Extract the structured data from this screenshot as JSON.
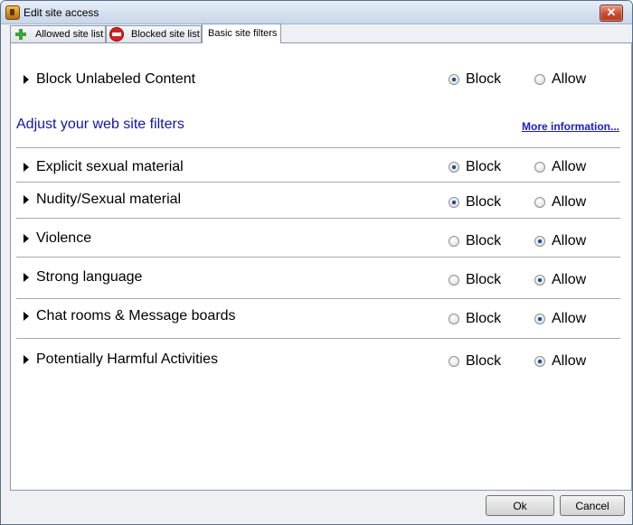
{
  "window": {
    "title": "Edit site access",
    "close_icon": "close-icon",
    "app_icon": "app-icon"
  },
  "tabs": [
    {
      "label": "Allowed site list",
      "icon": "plus-icon",
      "active": false
    },
    {
      "label": "Blocked site list",
      "icon": "block-icon",
      "active": false
    },
    {
      "label": "Basic site filters",
      "active": true
    }
  ],
  "unlabeled": {
    "label": "Block Unlabeled Content",
    "block_label": "Block",
    "allow_label": "Allow",
    "selected": "Block"
  },
  "filters_section": {
    "heading": "Adjust your web site filters",
    "more_link": "More information..."
  },
  "filters": [
    {
      "label": "Explicit sexual material",
      "block_label": "Block",
      "allow_label": "Allow",
      "selected": "Block"
    },
    {
      "label": "Nudity/Sexual material",
      "block_label": "Block",
      "allow_label": "Allow",
      "selected": "Block"
    },
    {
      "label": "Violence",
      "block_label": "Block",
      "allow_label": "Allow",
      "selected": "Allow"
    },
    {
      "label": "Strong language",
      "block_label": "Block",
      "allow_label": "Allow",
      "selected": "Allow"
    },
    {
      "label": "Chat rooms & Message boards",
      "block_label": "Block",
      "allow_label": "Allow",
      "selected": "Allow"
    },
    {
      "label": "Potentially Harmful Activities",
      "block_label": "Block",
      "allow_label": "Allow",
      "selected": "Allow"
    }
  ],
  "buttons": {
    "ok": "Ok",
    "cancel": "Cancel"
  },
  "colors": {
    "heading": "#1414a0",
    "link": "#1a1acc",
    "radio_dot": "#1d4f8e"
  }
}
